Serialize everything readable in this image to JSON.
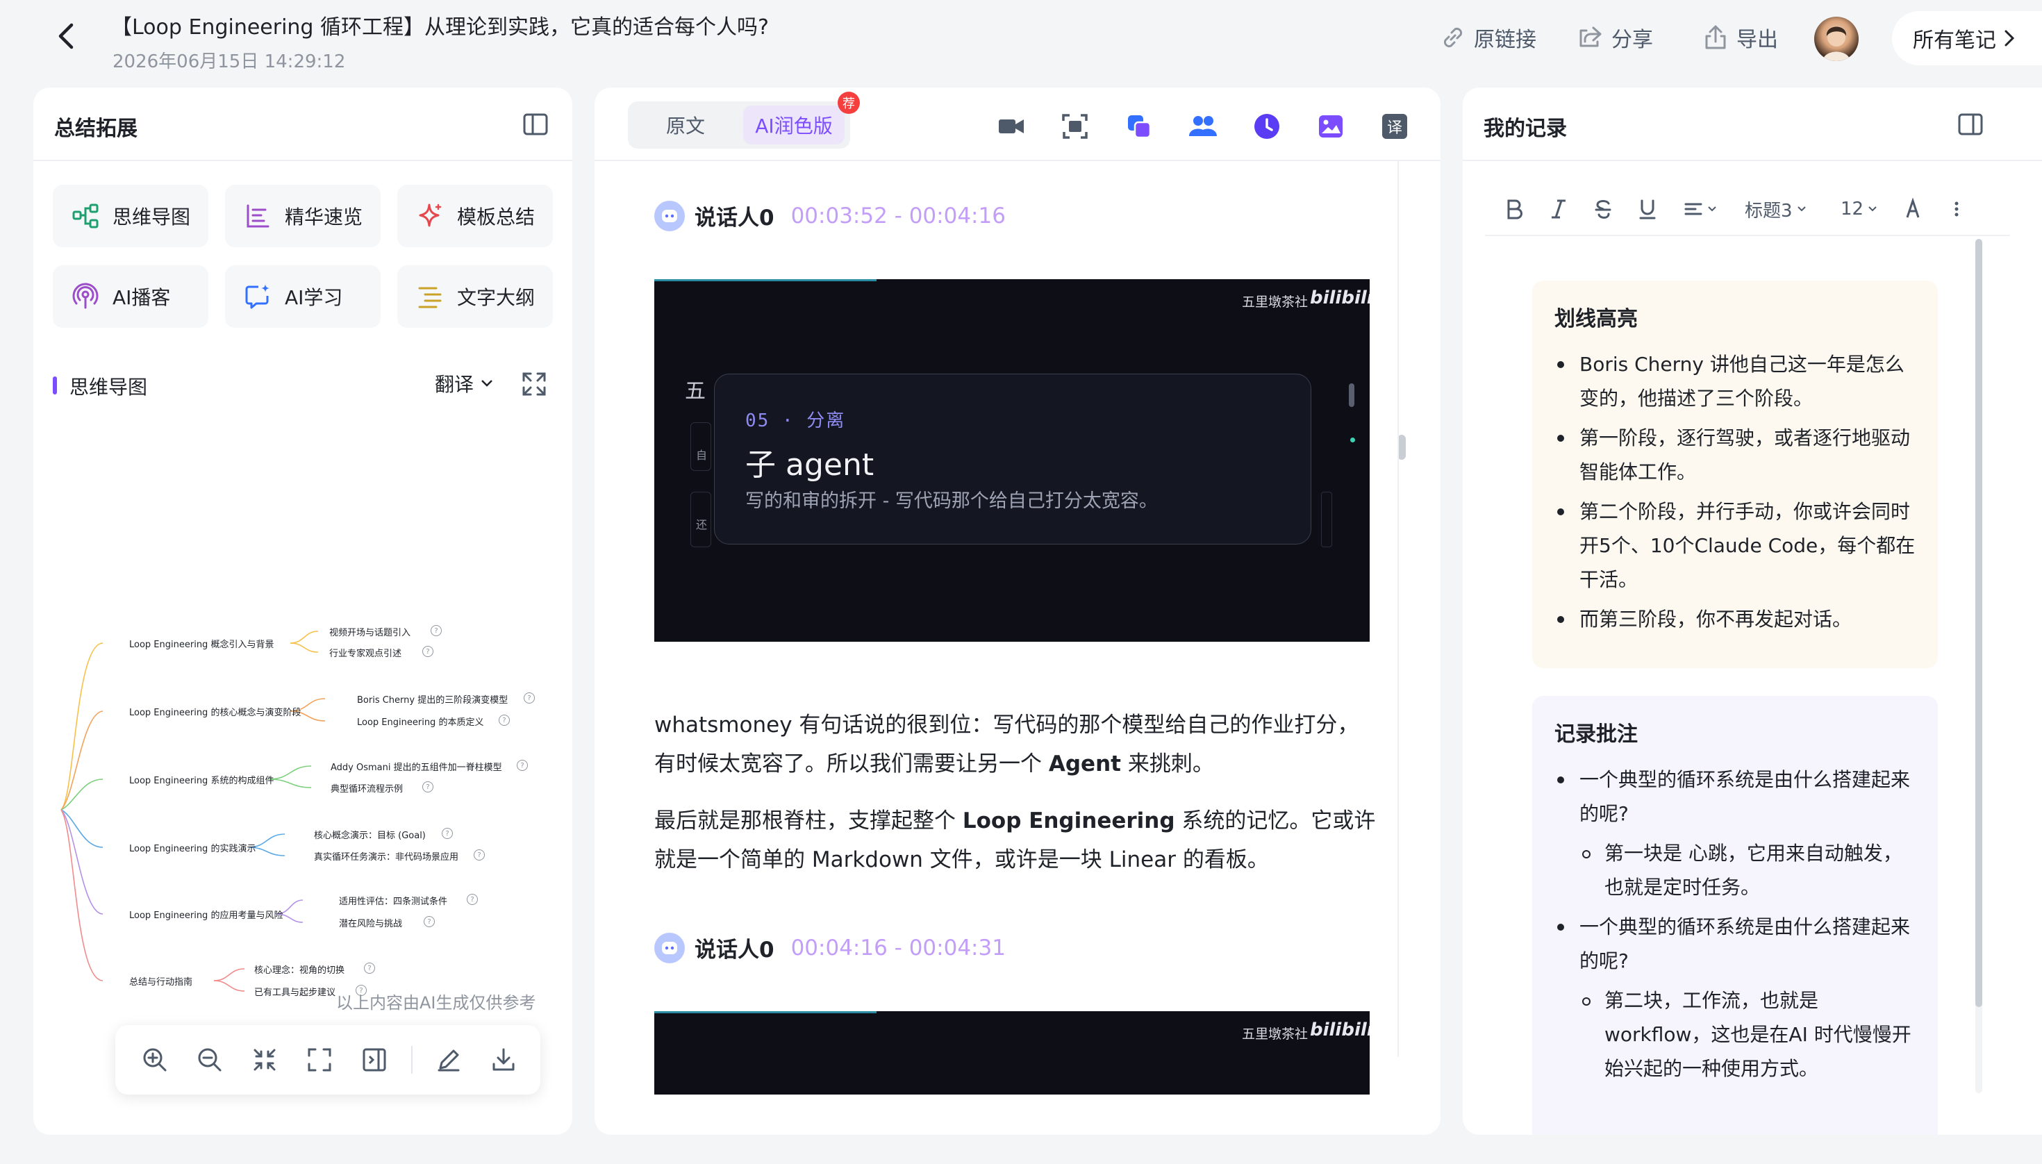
{
  "header": {
    "title": "【Loop Engineering 循环工程】从理论到实践，它真的适合每个人吗?",
    "date": "2026年06月15日 14:29:12",
    "actions": {
      "link": "原链接",
      "share": "分享",
      "export": "导出"
    },
    "all_notes": "所有笔记"
  },
  "left": {
    "title": "总结拓展",
    "cards": [
      {
        "label": "思维导图",
        "icon": "mindmap-icon",
        "color": "#1d9f6f"
      },
      {
        "label": "精华速览",
        "icon": "list-icon",
        "color": "#9b4dca"
      },
      {
        "label": "模板总结",
        "icon": "sparkle-icon",
        "color": "#e5484d"
      },
      {
        "label": "AI播客",
        "icon": "podcast-icon",
        "color": "#9b4dca"
      },
      {
        "label": "AI学习",
        "icon": "chat-sparkle-icon",
        "color": "#3370ff"
      },
      {
        "label": "文字大纲",
        "icon": "outline-icon",
        "color": "#c9a227"
      }
    ],
    "mindmap_title": "思维导图",
    "translate": "翻译",
    "mindmap": {
      "branches": [
        {
          "label": "Loop Engineering 概念引入与背景",
          "color": "#f7c04a",
          "children": [
            "视频开场与话题引入",
            "行业专家观点引述"
          ]
        },
        {
          "label": "Loop Engineering 的核心概念与演变阶段",
          "color": "#f2a35c",
          "children": [
            "Boris Cherny 提出的三阶段演变模型",
            "Loop Engineering 的本质定义"
          ]
        },
        {
          "label": "Loop Engineering 系统的构成组件",
          "color": "#7ccf7c",
          "children": [
            "Addy Osmani 提出的五组件加一脊柱模型",
            "典型循环流程示例"
          ]
        },
        {
          "label": "Loop Engineering 的实践演示",
          "color": "#5aa9e6",
          "children": [
            "核心概念演示：目标 (Goal)",
            "真实循环任务演示：非代码场景应用"
          ]
        },
        {
          "label": "Loop Engineering 的应用考量与风险",
          "color": "#b391e8",
          "children": [
            "适用性评估：四条测试条件",
            "潜在风险与挑战"
          ]
        },
        {
          "label": "总结与行动指南",
          "color": "#f28b8b",
          "children": [
            "核心理念：视角的切换",
            "已有工具与起步建议"
          ]
        }
      ]
    },
    "disclaimer": "以上内容由AI生成仅供参考"
  },
  "middle": {
    "tab_original": "原文",
    "tab_ai": "AI润色版",
    "badge": "荐",
    "segments": [
      {
        "speaker": "说话人0",
        "time": "00:03:52 - 00:04:16"
      },
      {
        "speaker": "说话人0",
        "time": "00:04:16 - 00:04:31"
      }
    ],
    "frame": {
      "watermark": "五里墩茶社",
      "brand": "bilibili",
      "side_char_1": "五",
      "side_char_2": "自",
      "side_char_3": "还",
      "tag": "05 · 分离",
      "heading": "子 agent",
      "sub": "写的和审的拆开 - 写代码那个给自己打分太宽容。"
    },
    "para1_a": "whatsmoney 有句话说的很到位：写代码的那个模型给自己的作业打分，有时候太宽容了。所以我们需要让另一个 ",
    "para1_b": "Agent",
    "para1_c": " 来挑刺。",
    "para2_a": "最后就是那根脊柱，支撑起整个 ",
    "para2_b": "Loop Engineering",
    "para2_c": " 系统的记忆。它或许就是一个简单的 Markdown 文件，或许是一块 Linear 的看板。"
  },
  "right": {
    "title": "我的记录",
    "toolbar": {
      "heading": "标题3",
      "size": "12"
    },
    "highlights_title": "划线高亮",
    "highlights": [
      "Boris Cherny 讲他自己这一年是怎么变的，他描述了三个阶段。",
      "第一阶段，逐行驾驶，或者逐行地驱动智能体工作。",
      "第二个阶段，并行手动，你或许会同时开5个、10个Claude Code，每个都在干活。",
      "而第三阶段，你不再发起对话。"
    ],
    "annot_title": "记录批注",
    "annotations": [
      {
        "text": "一个典型的循环系统是由什么搭建起来的呢?",
        "sub": "第一块是 心跳，它用来自动触发，也就是定时任务。"
      },
      {
        "text": "一个典型的循环系统是由什么搭建起来的呢?",
        "sub": "第二块，工作流，也就是 workflow，这也是在AI 时代慢慢开始兴起的一种使用方式。"
      }
    ]
  }
}
